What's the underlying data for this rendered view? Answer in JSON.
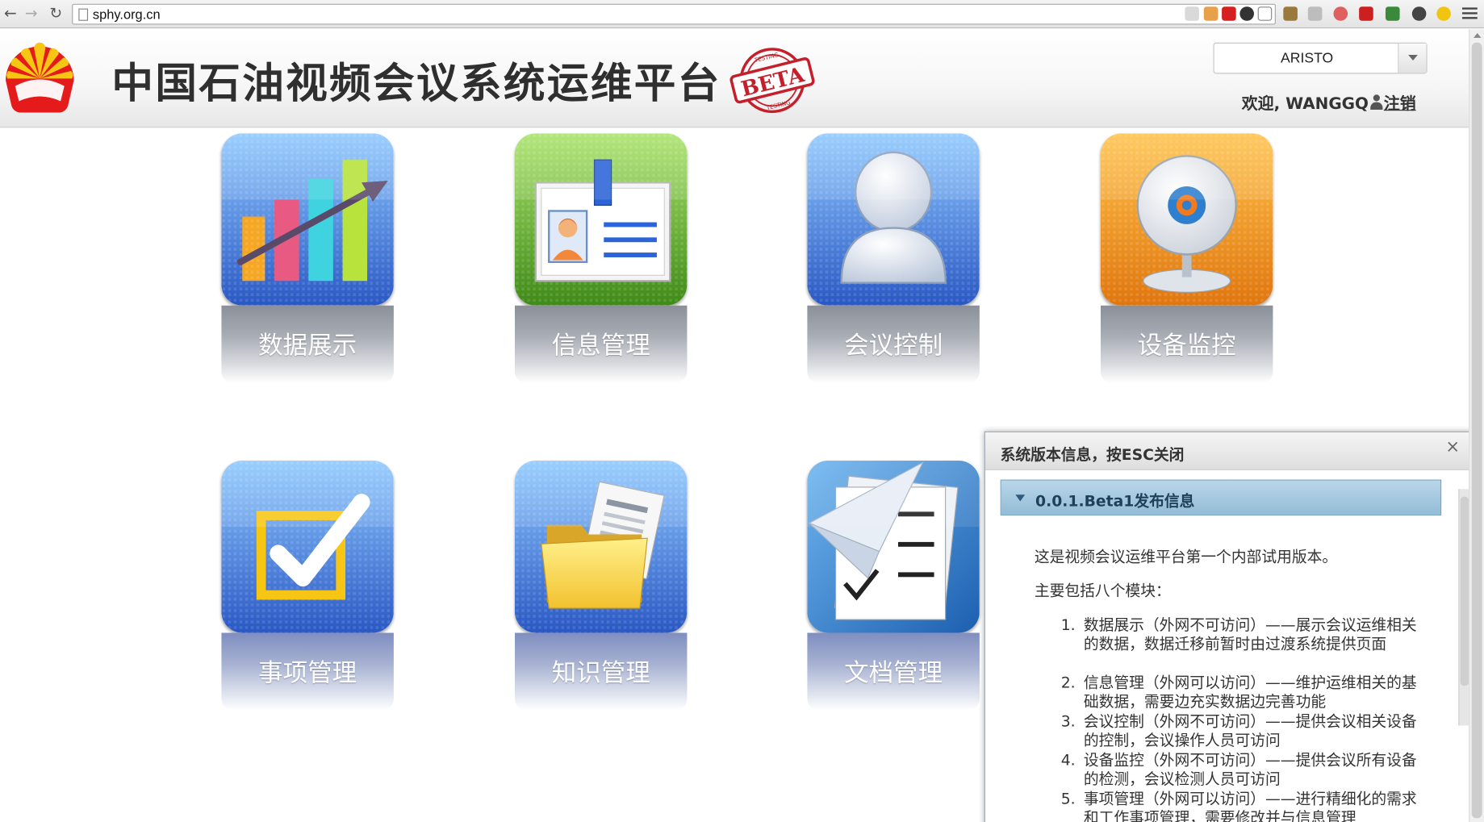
{
  "browser": {
    "url": "sphy.org.cn"
  },
  "header": {
    "title": "中国石油视频会议系统运维平台",
    "beta_text": "BETA",
    "stamp_small_text": "TESTING",
    "user_select": "ARISTO",
    "welcome": "欢迎, WANGGQ",
    "logout": "注销"
  },
  "tiles": [
    {
      "label": "数据展示",
      "icon": "bar-chart-icon"
    },
    {
      "label": "信息管理",
      "icon": "id-card-icon"
    },
    {
      "label": "会议控制",
      "icon": "user-silhouette-icon"
    },
    {
      "label": "设备监控",
      "icon": "webcam-icon"
    },
    {
      "label": "事项管理",
      "icon": "checkbox-icon"
    },
    {
      "label": "知识管理",
      "icon": "folder-icon"
    },
    {
      "label": "文档管理",
      "icon": "paper-plane-icon"
    }
  ],
  "modal": {
    "title": "系统版本信息，按ESC关闭",
    "section_title": "0.0.1.Beta1发布信息",
    "intro": "这是视频会议运维平台第一个内部试用版本。",
    "modules_heading": "主要包括八个模块：",
    "items": [
      {
        "num": "1.",
        "text": "数据展示（外网不可访问）——展示会议运维相关的数据，数据迁移前暂时由过渡系统提供页面"
      },
      {
        "num": "2.",
        "text": "信息管理（外网可以访问）——维护运维相关的基础数据，需要边充实数据边完善功能"
      },
      {
        "num": "3.",
        "text": "会议控制（外网不可访问）——提供会议相关设备的控制，会议操作人员可访问"
      },
      {
        "num": "4.",
        "text": "设备监控（外网不可访问）——提供会议所有设备的检测，会议检测人员可访问"
      },
      {
        "num": "5.",
        "text": "事项管理（外网可以访问）——进行精细化的需求和工作事项管理，需要修改并与信息管理"
      }
    ]
  },
  "colors": {
    "accordion": "#93bcd7",
    "tile_blue": "#3b6fd1",
    "tile_green": "#5aa52c",
    "tile_orange": "#e88a1a"
  }
}
